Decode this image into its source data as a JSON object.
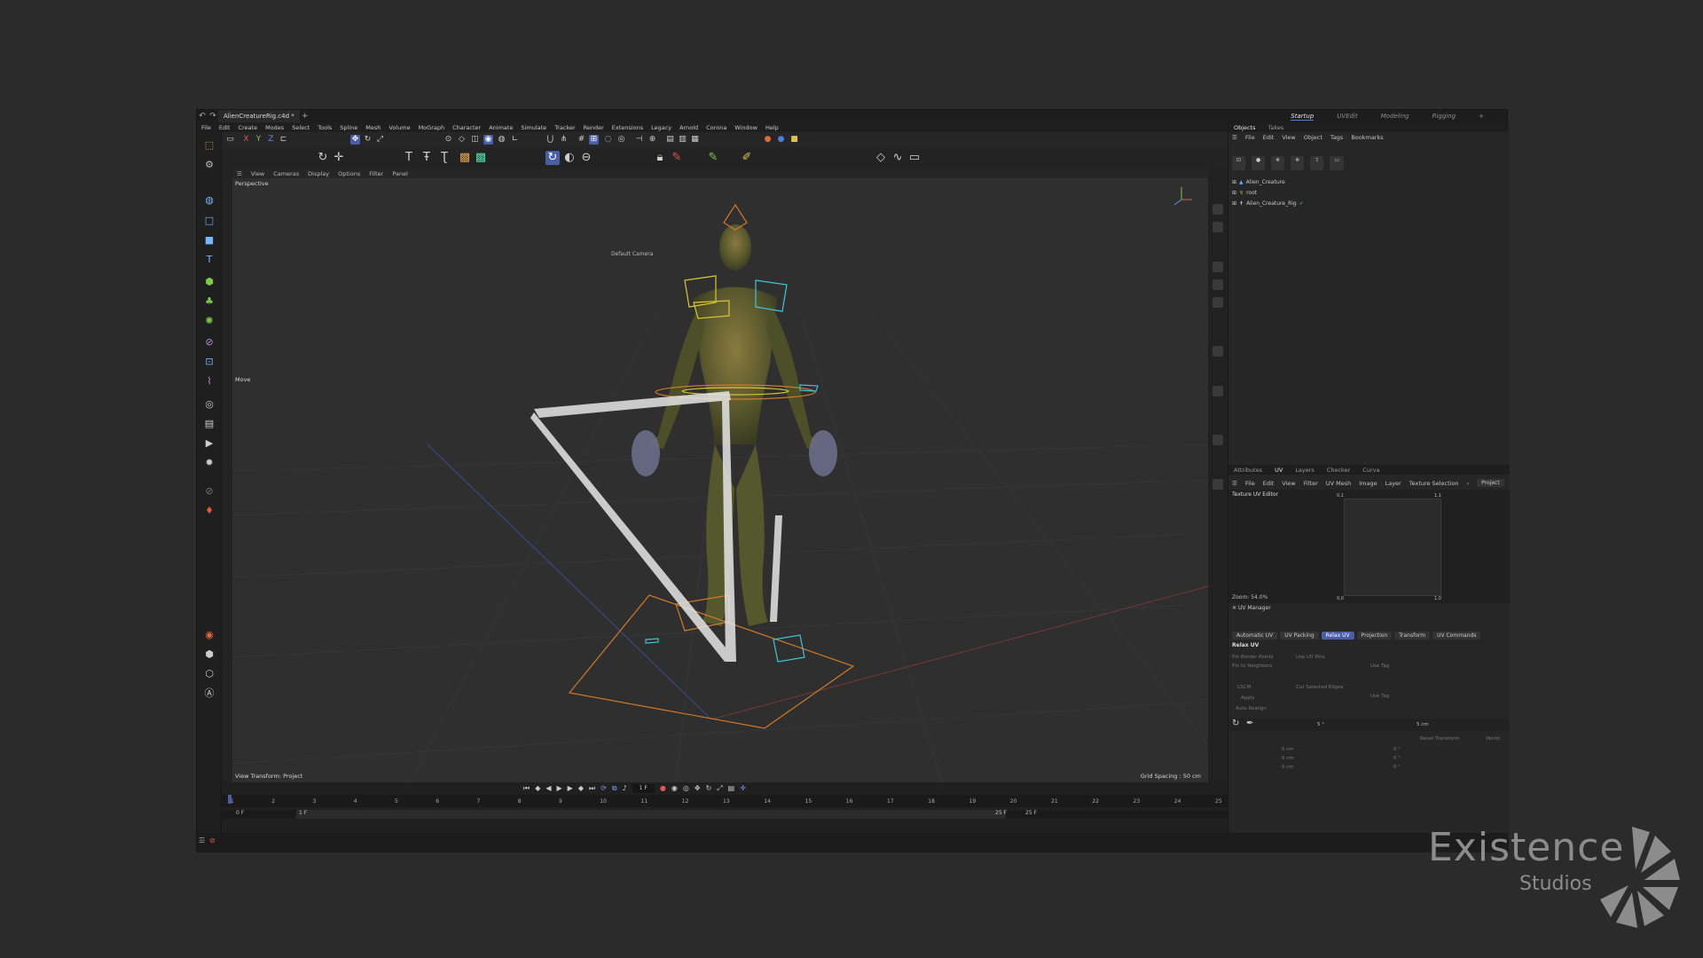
{
  "titlebar": {
    "doc_tab": "AlienCreatureRig.c4d *",
    "add_tab": "+"
  },
  "workspaces": [
    {
      "label": "Startup",
      "active": true
    },
    {
      "label": "UVEdit",
      "active": false
    },
    {
      "label": "Modeling",
      "active": false
    },
    {
      "label": "Rigging",
      "active": false
    }
  ],
  "menubar": [
    "File",
    "Edit",
    "Create",
    "Modes",
    "Select",
    "Tools",
    "Spline",
    "Mesh",
    "Volume",
    "MoGraph",
    "Character",
    "Animate",
    "Simulate",
    "Tracker",
    "Render",
    "Extensions",
    "Legacy",
    "Arnold",
    "Corona",
    "Window",
    "Help"
  ],
  "viewport": {
    "menu": [
      "View",
      "Cameras",
      "Display",
      "Options",
      "Filter",
      "Panel"
    ],
    "projection": "Perspective",
    "camera": "Default Camera",
    "tool_hint": "Move",
    "view_transform": "View Transform: Project",
    "grid_spacing": "Grid Spacing : 50 cm"
  },
  "objects_panel": {
    "tabs": [
      "Objects",
      "Takes"
    ],
    "menu": [
      "File",
      "Edit",
      "View",
      "Object",
      "Tags",
      "Bookmarks"
    ],
    "items": [
      "Alien_Creature",
      "root",
      "Alien_Creature_Rig"
    ]
  },
  "lower_panel": {
    "tabs": [
      "Attributes",
      "UV",
      "Layers",
      "Checker",
      "Curva"
    ],
    "menu": [
      "File",
      "Edit",
      "View",
      "Filter",
      "UV Mesh",
      "Image",
      "Layer",
      "Texture Selection"
    ],
    "project_button": "Project",
    "uv_editor_title": "Texture UV Editor",
    "uv_corner_tl": "0,1",
    "uv_corner_tr": "1,1",
    "uv_corner_bl": "0,0",
    "uv_corner_br": "1,0",
    "zoom": "Zoom: 54.0%",
    "uv_manager_title": "UV Manager",
    "uv_tabs": [
      {
        "label": "Automatic UV",
        "active": false
      },
      {
        "label": "UV Packing",
        "active": false
      },
      {
        "label": "Relax UV",
        "active": true
      },
      {
        "label": "Projection",
        "active": false
      },
      {
        "label": "Transform",
        "active": false
      },
      {
        "label": "UV Commands",
        "active": false
      }
    ],
    "section": "Relax UV",
    "params": {
      "pin_border": "Pin Border Points",
      "pin_neighbors": "Pin to Neighbors",
      "use_uv_pins": "Use UV Pins",
      "use_tag_1": "Use Tag",
      "lscm": "LSCM",
      "cut_selected": "Cut Selected Edges",
      "apply": "Apply",
      "use_tag_2": "Use Tag",
      "auto_realign": "Auto Realign"
    },
    "transform": {
      "angle": "5 °",
      "size": "5 cm",
      "reset": "Reset Transform",
      "world": "World",
      "x": "0 cm",
      "y": "0 cm",
      "z": "0 cm",
      "rx": "0 °",
      "ry": "0 °",
      "rz": "0 °"
    }
  },
  "timeline": {
    "current_frame": "1 F",
    "start": "0 F",
    "range_start": "1 F",
    "range_end": "25 F",
    "end": "25 F",
    "ticks": [
      "1",
      "2",
      "3",
      "4",
      "5",
      "6",
      "7",
      "8",
      "9",
      "10",
      "11",
      "12",
      "13",
      "14",
      "15",
      "16",
      "17",
      "18",
      "19",
      "20",
      "21",
      "22",
      "23",
      "24",
      "25"
    ]
  },
  "branding": {
    "line1": "Existence",
    "line2": "Studios"
  },
  "colors": {
    "accent": "#4a5ea8",
    "viewport_bg": "#2f2f2f",
    "rig_orange": "#d07a2a",
    "rig_cyan": "#3fc4d8",
    "rig_yellow": "#d8c832"
  }
}
